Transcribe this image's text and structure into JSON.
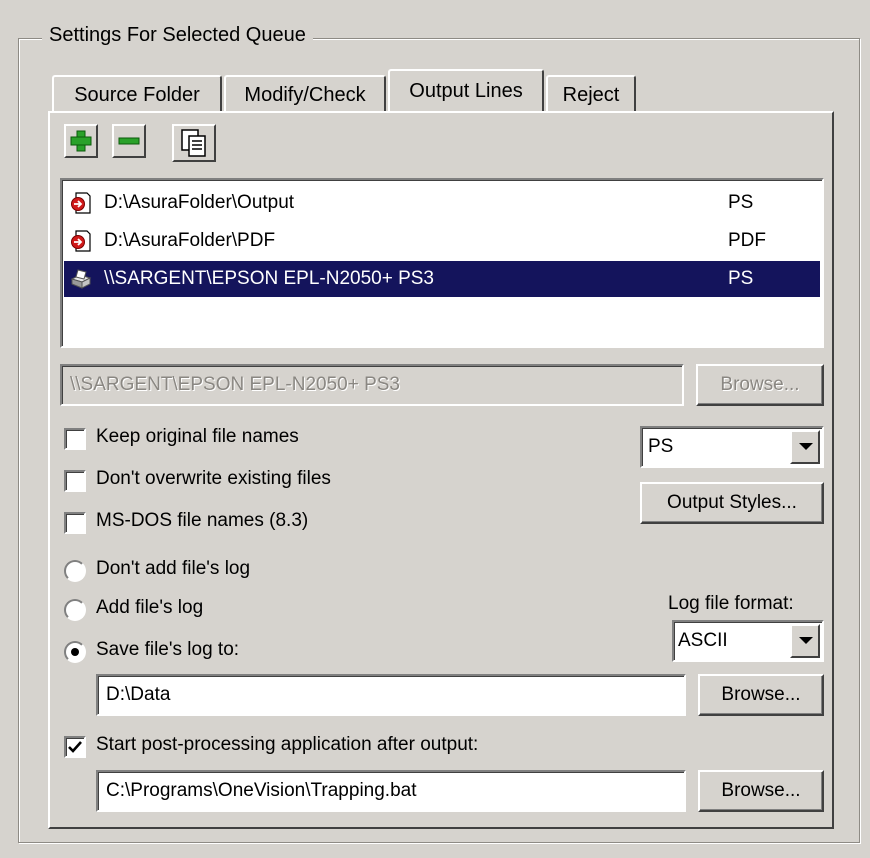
{
  "group": {
    "title": "Settings For Selected Queue"
  },
  "tabs": [
    {
      "label": "Source Folder",
      "active": false
    },
    {
      "label": "Modify/Check",
      "active": false
    },
    {
      "label": "Output Lines",
      "active": true
    },
    {
      "label": "Reject",
      "active": false
    }
  ],
  "toolbar": {
    "add_icon": "plus-icon",
    "remove_icon": "minus-icon",
    "copy_icon": "copy-icon"
  },
  "output_list": [
    {
      "path": "D:\\AsuraFolder\\Output",
      "format": "PS",
      "icon": "folder-output-icon",
      "selected": false
    },
    {
      "path": "D:\\AsuraFolder\\PDF",
      "format": "PDF",
      "icon": "folder-output-icon",
      "selected": false
    },
    {
      "path": "\\\\SARGENT\\EPSON EPL-N2050+ PS3",
      "format": "PS",
      "icon": "printer-icon",
      "selected": true
    }
  ],
  "path_field": {
    "value": "\\\\SARGENT\\EPSON EPL-N2050+ PS3",
    "enabled": false
  },
  "browse_label": "Browse...",
  "options": {
    "keep_names": {
      "label": "Keep original file names",
      "checked": false
    },
    "no_overwrite": {
      "label": "Don't overwrite existing files",
      "checked": false
    },
    "msdos_names": {
      "label": "MS-DOS file names (8.3)",
      "checked": false
    }
  },
  "format_select": {
    "value": "PS"
  },
  "output_styles_label": "Output Styles...",
  "log": {
    "dont_add": {
      "label": "Don't add file's log",
      "selected": false
    },
    "add": {
      "label": "Add file's log",
      "selected": false
    },
    "save_to": {
      "label": "Save file's log to:",
      "selected": true
    },
    "format_label": "Log file format:",
    "format_value": "ASCII",
    "path": "D:\\Data"
  },
  "post": {
    "label": "Start post-processing application after output:",
    "checked": true,
    "path": "C:\\Programs\\OneVision\\Trapping.bat"
  }
}
